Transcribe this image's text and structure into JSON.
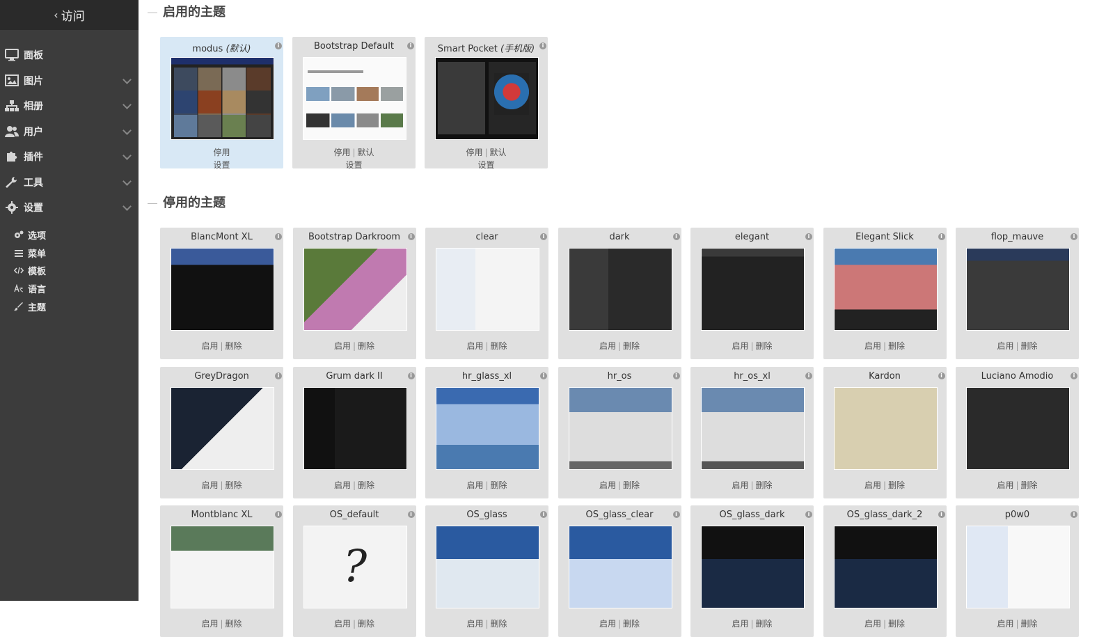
{
  "sidebar": {
    "visit_label": "访问",
    "items": [
      {
        "label": "面板",
        "icon": "monitor-icon",
        "expandable": false
      },
      {
        "label": "图片",
        "icon": "image-icon",
        "expandable": true
      },
      {
        "label": "相册",
        "icon": "sitemap-icon",
        "expandable": true
      },
      {
        "label": "用户",
        "icon": "users-icon",
        "expandable": true
      },
      {
        "label": "插件",
        "icon": "puzzle-icon",
        "expandable": true
      },
      {
        "label": "工具",
        "icon": "wrench-icon",
        "expandable": true
      },
      {
        "label": "设置",
        "icon": "gear-icon",
        "expandable": true
      }
    ],
    "subitems": [
      {
        "label": "选项",
        "icon": "cogs-icon"
      },
      {
        "label": "菜单",
        "icon": "bars-icon"
      },
      {
        "label": "模板",
        "icon": "code-icon"
      },
      {
        "label": "语言",
        "icon": "language-icon"
      },
      {
        "label": "主题",
        "icon": "brush-icon"
      }
    ]
  },
  "active_section": {
    "title": "启用的主题",
    "themes": [
      {
        "name": "modus",
        "suffix": "(默认)",
        "actions": [
          "停用"
        ],
        "action2": "设置",
        "is_default": true
      },
      {
        "name": "Bootstrap Default",
        "suffix": "",
        "actions": [
          "停用",
          "默认"
        ],
        "action2": "设置",
        "is_default": false
      },
      {
        "name": "Smart Pocket",
        "suffix": "(手机版)",
        "actions": [
          "停用",
          "默认"
        ],
        "action2": "设置",
        "is_default": false
      }
    ]
  },
  "inactive_section": {
    "title": "停用的主题",
    "action_enable": "启用",
    "action_delete": "删除",
    "themes": [
      "BlancMont XL",
      "Bootstrap Darkroom",
      "clear",
      "dark",
      "elegant",
      "Elegant Slick",
      "flop_mauve",
      "GreyDragon",
      "Grum dark II",
      "hr_glass_xl",
      "hr_os",
      "hr_os_xl",
      "Kardon",
      "Luciano Amodio",
      "Montblanc XL",
      "OS_default",
      "OS_glass",
      "OS_glass_clear",
      "OS_glass_dark",
      "OS_glass_dark_2",
      "p0w0"
    ],
    "missing_preview_glyph": "?"
  },
  "colors": {
    "sidebar_bg": "#3c3c3c",
    "card_bg": "#e0e0e0",
    "default_card_bg": "#d8e8f5"
  }
}
